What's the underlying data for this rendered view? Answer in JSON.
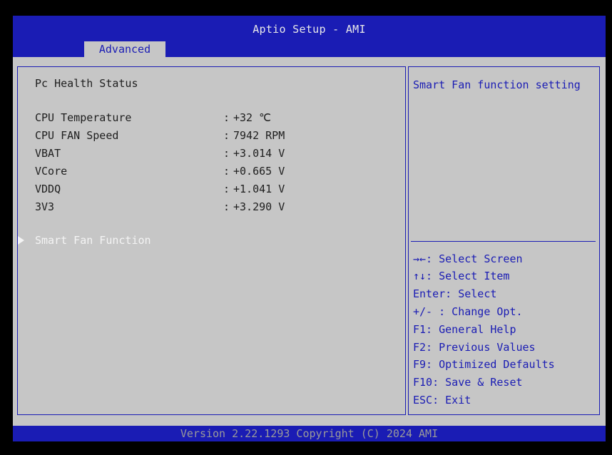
{
  "header": {
    "title": "Aptio Setup - AMI",
    "tabs": [
      {
        "label": "Advanced",
        "active": true
      }
    ]
  },
  "main": {
    "section_title": "Pc Health Status",
    "readings": [
      {
        "label": "CPU Temperature",
        "value": "+32 ℃"
      },
      {
        "label": "CPU FAN Speed",
        "value": "7942 RPM"
      },
      {
        "label": "VBAT",
        "value": "+3.014 V"
      },
      {
        "label": "VCore",
        "value": "+0.665 V"
      },
      {
        "label": "VDDQ",
        "value": "+1.041 V"
      },
      {
        "label": "3V3",
        "value": "+3.290 V"
      }
    ],
    "separator": ":",
    "submenu": {
      "label": "Smart Fan Function",
      "selected": true
    }
  },
  "help": {
    "description": "Smart Fan function setting",
    "keys": [
      {
        "key": "→←:",
        "action": " Select Screen"
      },
      {
        "key": "↑↓:",
        "action": " Select Item"
      },
      {
        "key": "Enter:",
        "action": " Select"
      },
      {
        "key": "+/- :",
        "action": " Change Opt."
      },
      {
        "key": "F1:",
        "action": " General Help"
      },
      {
        "key": "F2:",
        "action": " Previous Values"
      },
      {
        "key": "F9:",
        "action": " Optimized Defaults"
      },
      {
        "key": "F10:",
        "action": " Save & Reset"
      },
      {
        "key": "ESC:",
        "action": " Exit"
      }
    ]
  },
  "footer": {
    "version_text": "Version 2.22.1293 Copyright (C) 2024 AMI"
  },
  "colors": {
    "bios_blue": "#1a1cb4",
    "panel_gray": "#c6c6c6",
    "text_dark": "#1e1e1e",
    "text_white": "#f4f4f4",
    "footer_text": "#9a9a9a"
  }
}
